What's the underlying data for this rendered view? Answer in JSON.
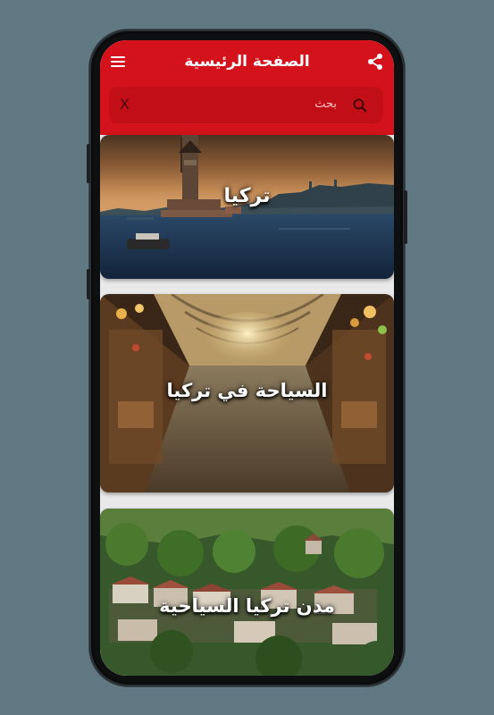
{
  "appbar": {
    "title": "الصفحة الرئيسية",
    "menu_icon": "hamburger-menu-icon",
    "share_icon": "share-icon",
    "background": "#d4121b"
  },
  "search": {
    "placeholder": "بحث",
    "clear_label": "X",
    "icon": "search-icon"
  },
  "cards": [
    {
      "label": "تركيا",
      "image": "istanbul-maidens-tower-photo"
    },
    {
      "label": "السياحة في تركيا",
      "image": "grand-bazaar-photo"
    },
    {
      "label": "مدن تركيا السياحية",
      "image": "turkish-hillside-town-photo"
    }
  ]
}
